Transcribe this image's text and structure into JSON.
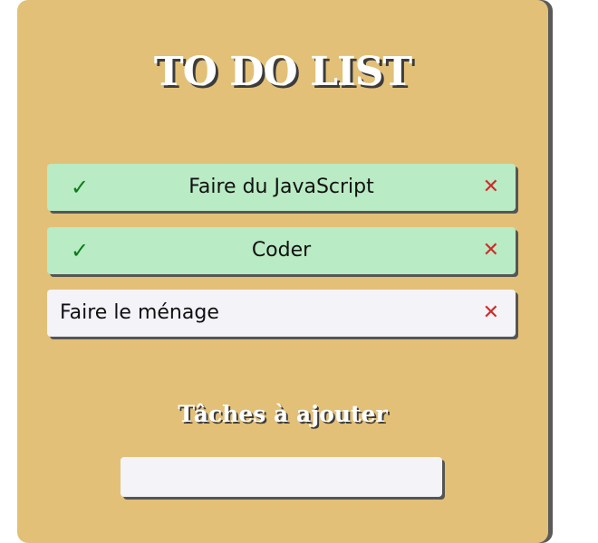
{
  "header": {
    "title": "TO DO LIST"
  },
  "todos": [
    {
      "label": "Faire du JavaScript",
      "done": true,
      "check_icon": "✓",
      "delete_icon": "✕"
    },
    {
      "label": "Coder",
      "done": true,
      "check_icon": "✓",
      "delete_icon": "✕"
    },
    {
      "label": "Faire le ménage",
      "done": false,
      "delete_icon": "✕"
    }
  ],
  "add_task": {
    "heading": "Tâches à ajouter",
    "value": "",
    "placeholder": ""
  },
  "colors": {
    "card_background": "#e3c077",
    "done_background": "#b9ebc4",
    "pending_background": "#f4f3f8",
    "check_color": "#0a7d18",
    "delete_color": "#cf2c2c"
  },
  "icons": {
    "check": "check-icon",
    "delete": "close-icon"
  }
}
